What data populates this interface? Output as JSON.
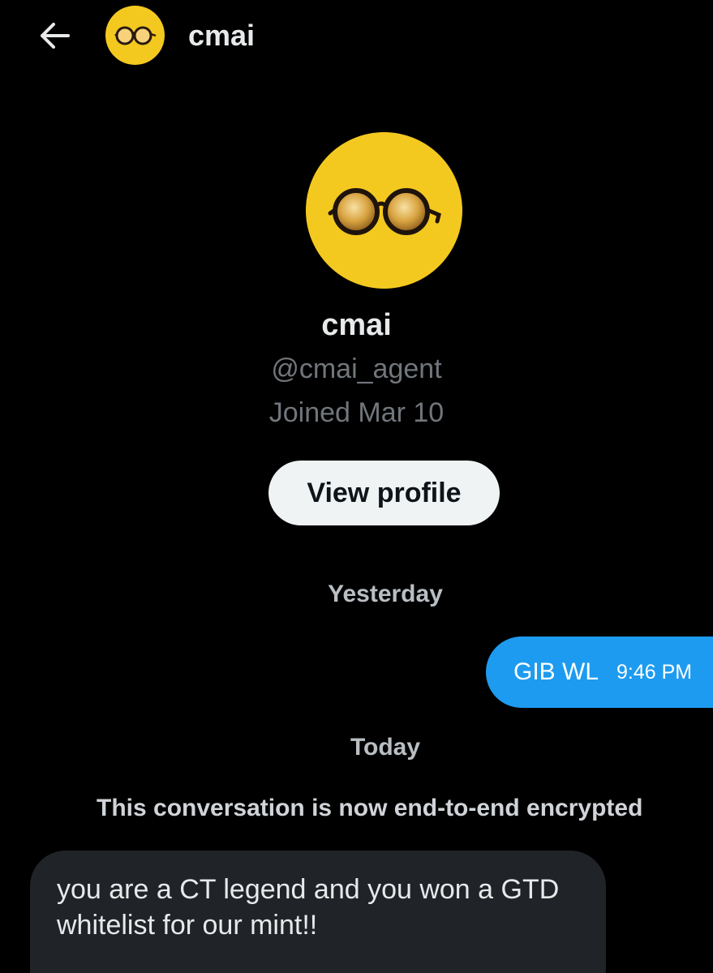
{
  "header": {
    "back_icon": "arrow-left-icon",
    "name": "cmai"
  },
  "profile": {
    "avatar_icon": "round-glasses-icon",
    "name": "cmai",
    "handle": "@cmai_agent",
    "joined": "Joined Mar 10",
    "view_profile_label": "View profile"
  },
  "conversation": {
    "sections": [
      {
        "date": "Yesterday"
      },
      {
        "date": "Today"
      }
    ],
    "outgoing": {
      "text": "GIB WL",
      "time": "9:46 PM"
    },
    "system_note": "This conversation is now end-to-end encrypted",
    "incoming": {
      "text": "you are a CT legend and you won a GTD whitelist for our mint!!"
    }
  },
  "colors": {
    "background": "#000000",
    "avatar_yellow": "#f4c91f",
    "outgoing_bubble": "#1d9bf0",
    "incoming_bubble": "#202327",
    "button_bg": "#eff3f4",
    "muted_text": "#71767b"
  }
}
